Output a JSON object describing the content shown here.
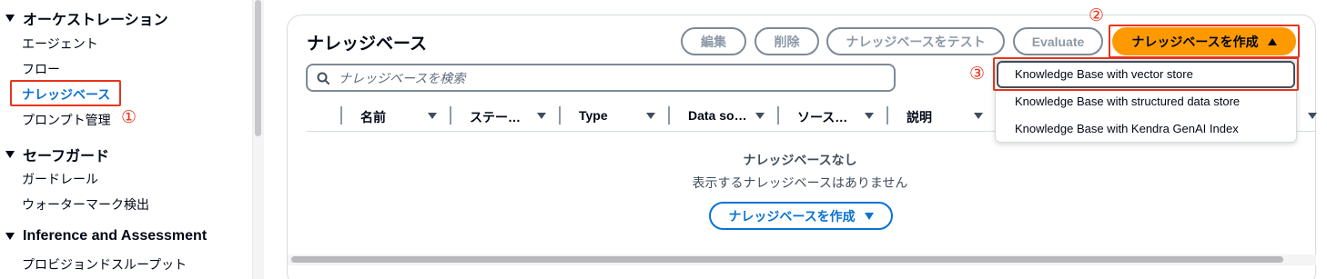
{
  "sidebar": {
    "sections": [
      {
        "title": "オーケストレーション",
        "items": [
          "エージェント",
          "フロー",
          "ナレッジベース",
          "プロンプト管理"
        ]
      },
      {
        "title": "セーフガード",
        "items": [
          "ガードレール",
          "ウォーターマーク検出"
        ]
      },
      {
        "title": "Inference and Assessment",
        "items": [
          "プロビジョンドスループット"
        ]
      }
    ]
  },
  "annotations": {
    "one": "①",
    "two": "②",
    "three": "③"
  },
  "panel": {
    "title": "ナレッジベース",
    "buttons": {
      "edit": "編集",
      "delete": "削除",
      "test": "ナレッジベースをテスト",
      "evaluate": "Evaluate",
      "create": "ナレッジベースを作成"
    },
    "search_placeholder": "ナレッジベースを検索",
    "columns": [
      "名前",
      "ステー…",
      "Type",
      "Data so…",
      "ソース…",
      "説明"
    ],
    "empty": {
      "title": "ナレッジベースなし",
      "description": "表示するナレッジベースはありません",
      "button": "ナレッジベースを作成"
    }
  },
  "dropdown": {
    "items": [
      "Knowledge Base with vector store",
      "Knowledge Base with structured data store",
      "Knowledge Base with Kendra GenAI Index"
    ]
  },
  "colors": {
    "accent": "#ff9900",
    "link": "#0972d3",
    "highlight": "#e8341c"
  }
}
